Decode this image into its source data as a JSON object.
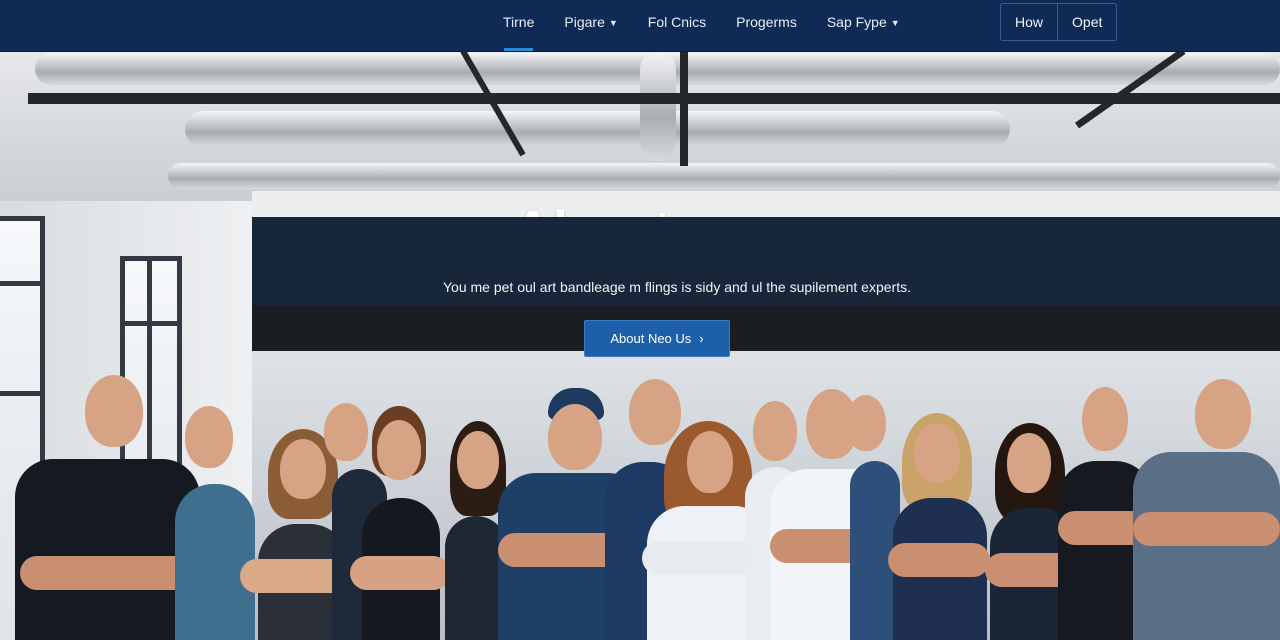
{
  "nav": {
    "links": [
      {
        "label": "Tirne",
        "dropdown": false,
        "active": true
      },
      {
        "label": "Pigare",
        "dropdown": true,
        "active": false
      },
      {
        "label": "Fol Cnics",
        "dropdown": false,
        "active": false
      },
      {
        "label": "Progerms",
        "dropdown": false,
        "active": false
      },
      {
        "label": "Sap Fype",
        "dropdown": true,
        "active": false
      }
    ],
    "buttons": {
      "left": "How",
      "right": "Opet"
    }
  },
  "hero": {
    "title": "About us.",
    "subtitle": "You me pet oul art bandleage m flings is sidy and ul the supilement experts.",
    "cta": "About Neo Us"
  },
  "colors": {
    "nav_bg": "#0f2a55",
    "accent": "#2b8ad8",
    "cta_bg": "#1d5fa8",
    "band_bg": "#18263a"
  },
  "icons": {
    "dropdown": "chevron-down-icon",
    "cta": "chevron-right-icon"
  }
}
